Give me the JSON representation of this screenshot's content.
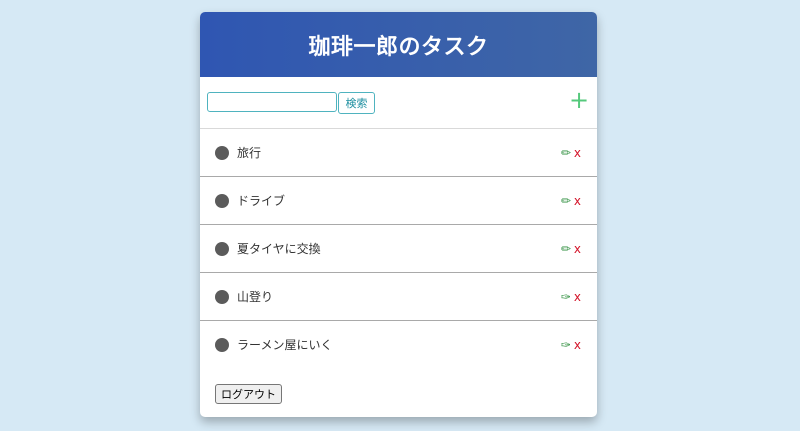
{
  "app": {
    "title": "珈琲一郎のタスク"
  },
  "search": {
    "value": "",
    "placeholder": "",
    "button_label": "検索"
  },
  "toolbar": {
    "add_label": "+"
  },
  "tasks": [
    {
      "label": "旅行",
      "edit_icon": "✏",
      "delete_label": "x"
    },
    {
      "label": "ドライブ",
      "edit_icon": "✏",
      "delete_label": "x"
    },
    {
      "label": "夏タイヤに交換",
      "edit_icon": "✏",
      "delete_label": "x"
    },
    {
      "label": "山登り",
      "edit_icon": "✑",
      "delete_label": "x"
    },
    {
      "label": "ラーメン屋にいく",
      "edit_icon": "✑",
      "delete_label": "x"
    }
  ],
  "footer": {
    "logout_label": "ログアウト"
  },
  "colors": {
    "background": "#d6e9f5",
    "header_gradient_start": "#2f56b2",
    "header_gradient_end": "#3f66a6",
    "accent": "#4fb3bf",
    "add_icon": "#55c97c",
    "edit_icon": "#2f8f3f",
    "delete_icon": "#d4142a",
    "bullet": "#5b5b5b"
  }
}
